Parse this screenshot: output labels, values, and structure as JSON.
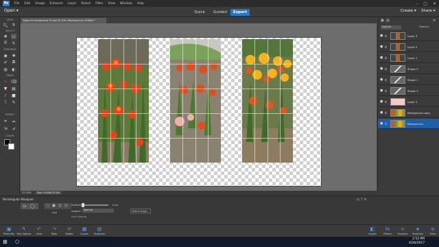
{
  "menu": {
    "logo": "Ps",
    "items": [
      "File",
      "Edit",
      "Image",
      "Enhance",
      "Layer",
      "Select",
      "Filter",
      "View",
      "Window",
      "Help"
    ],
    "window_controls": [
      "–",
      "□",
      "✕"
    ]
  },
  "modebar": {
    "open_label": "Open ▾",
    "tabs": [
      "Quick",
      "Guided",
      "Expert"
    ],
    "active_tab": "Expert",
    "create_label": "Create ▾",
    "share_label": "Share ▾"
  },
  "document": {
    "tab_title": "Tulips for Pohotoshot 2T.psd @ 30% (Background, RGB/8) *",
    "zoom": "33.33%",
    "info": "Doc: 25.0M/73.1M"
  },
  "toolbar": {
    "sections": [
      "VIEW",
      "SELECT",
      "ENHANCE",
      "DRAW",
      "MODIFY",
      "COLOR"
    ]
  },
  "layers": {
    "blend_mode": "Normal",
    "opacity_label": "Opacity:",
    "items": [
      {
        "name": "Layer 3",
        "thumb": "tulips"
      },
      {
        "name": "Layer 2",
        "thumb": "tulips"
      },
      {
        "name": "Layer 1",
        "thumb": "tulips"
      },
      {
        "name": "Shape 2",
        "thumb": "shape"
      },
      {
        "name": "Shape 1",
        "thumb": "shape"
      },
      {
        "name": "Shape 3",
        "thumb": "shape"
      },
      {
        "name": "Layer 4",
        "thumb": "pink"
      },
      {
        "name": "Background copy",
        "thumb": "photo"
      },
      {
        "name": "Background",
        "thumb": "photo"
      }
    ],
    "selected": "Background"
  },
  "tool_options": {
    "title": "Rectangular Marquee",
    "add_label": "Add",
    "feather_label": "Feather:",
    "feather_value": "0 px",
    "aspect_label": "Aspect:",
    "aspect_value": "Normal",
    "antialias_label": "Anti-aliasing",
    "refine_label": "Refine Edge..."
  },
  "bottom": {
    "left_buttons": [
      {
        "icon": "▣",
        "label": "Photo Bin"
      },
      {
        "icon": "✎",
        "label": "Tool Options"
      },
      {
        "icon": "↶",
        "label": "Undo"
      },
      {
        "icon": "↷",
        "label": "Redo"
      },
      {
        "icon": "⟳",
        "label": "Rotate"
      },
      {
        "icon": "▦",
        "label": "Layout"
      },
      {
        "icon": "▤",
        "label": "Organizer"
      }
    ],
    "right_buttons": [
      {
        "icon": "◧",
        "label": "Layers"
      },
      {
        "icon": "fx",
        "label": "Effects"
      },
      {
        "icon": "+",
        "label": "Graphics"
      },
      {
        "icon": "★",
        "label": "Favorites"
      },
      {
        "icon": "≡",
        "label": "More"
      }
    ]
  },
  "taskbar": {
    "start_icon": "⊞",
    "search_icon": "○",
    "time": "2:53 PM",
    "date": "4/26/2017"
  },
  "colors": {
    "accent": "#1f78d6",
    "panel": "#3b3b3b",
    "workspace": "#6d6d6d"
  }
}
